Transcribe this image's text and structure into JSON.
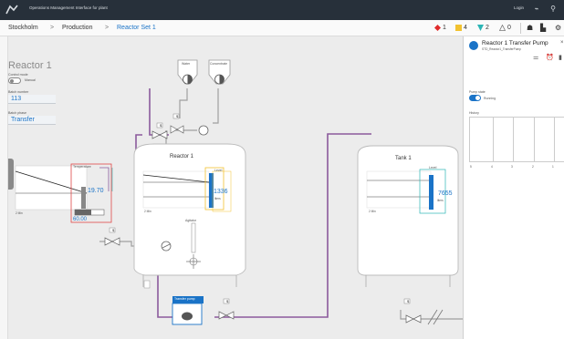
{
  "titlebar": {
    "app_title": "Operations Management Interface for plant",
    "login_label": "Login",
    "icons": [
      "app-logo-icon",
      "network-icon",
      "user-icon"
    ]
  },
  "breadcrumb": {
    "items": [
      "Stockholm",
      "Production",
      "Reactor Set 1"
    ],
    "separator": ">"
  },
  "alarms": {
    "critical": "1",
    "warning": "4",
    "info": "2",
    "acknowledged": "0"
  },
  "reactor1_panel": {
    "title": "Reactor 1",
    "control_mode_label": "Control mode",
    "control_mode_value": "Manual",
    "batch_number_label": "Batch number",
    "batch_number_value": "113",
    "batch_phase_label": "Batch phase",
    "batch_phase_value": "Transfer"
  },
  "process": {
    "water_label": "Water",
    "concentrate_label": "Concentrate",
    "reactor_label": "Reactor 1",
    "tank_label": "Tank 1",
    "reactor_level_label": "Level",
    "reactor_level_value": "1336",
    "reactor_level_unit": "liters",
    "tank_level_label": "Level",
    "tank_level_value": "7655",
    "tank_level_unit": "liters",
    "agitator_label": "Agitator",
    "temperature_label": "Temperature",
    "temperature_value": "19.70",
    "temperature_setpoint": "60.00",
    "temperature_unit": "°C",
    "transfer_pump_label": "Transfer pump",
    "trend_time_left": "2 Min",
    "trend_time_reactor": "2 Min",
    "trend_time_tank": "2 Min",
    "valve_badge": "$"
  },
  "right_panel": {
    "title": "Reactor 1 Transfer Pump",
    "subtitle": "STD_Reactor1_TransferPump",
    "pump_state_label": "Pump state",
    "pump_state_value": "Running",
    "history_label": "History",
    "history_ticks": [
      "5",
      "4",
      "3",
      "2",
      "1"
    ],
    "colors": {
      "accent": "#1a73c7",
      "running": "#1a73c7"
    }
  },
  "colors": {
    "titlebar": "#27303a",
    "canvas": "#ececec",
    "pipe_purple": "#8b5a9c",
    "pipe_gray": "#9a9a9a",
    "alarm_red": "#e02b2b",
    "alarm_yellow": "#f2c230",
    "alarm_teal": "#2bb5b5",
    "level_blue": "#1a73c7",
    "setpoint_red": "#e04646",
    "level_yellow": "#f2c230"
  }
}
